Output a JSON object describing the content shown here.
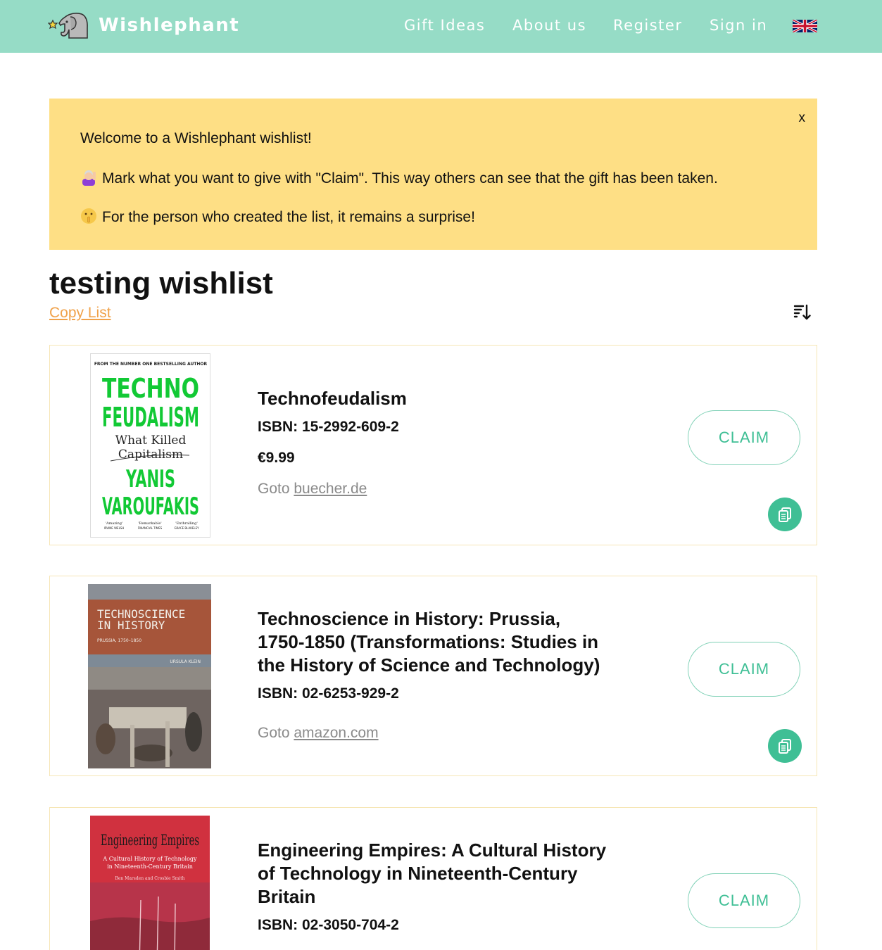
{
  "header": {
    "brand": "Wishlephant",
    "nav": [
      "Gift Ideas",
      "About us",
      "Register",
      "Sign in"
    ],
    "language_icon": "uk-flag-icon",
    "bg_color": "#96dcc6"
  },
  "notice": {
    "close": "x",
    "line1": "Welcome to a Wishlephant wishlist!",
    "line2": "Mark what you want to give with \"Claim\". This way others can see that the gift has been taken.",
    "line3": "For the person who created the list, it remains a surprise!",
    "line2_icon": "woman-raising-hand-icon",
    "line3_icon": "shushing-face-icon",
    "bg_color": "#fedf85"
  },
  "list": {
    "title": "testing wishlist",
    "copy_label": "Copy List",
    "sort_icon": "sort-descending-icon"
  },
  "items": [
    {
      "title": "Technofeudalism",
      "isbn": "ISBN: 15-2992-609-2",
      "price": "€9.99",
      "goto_prefix": "Goto",
      "goto_link": "buecher.de",
      "claim": "CLAIM",
      "cover": {
        "top": "FROM THE NUMBER ONE BESTSELLING AUTHOR",
        "title1": "TECHNO",
        "title2": "FEUDALISM",
        "sub1": "What Killed",
        "sub2": "Capitalism",
        "author1": "YANIS",
        "author2": "VAROUFAKIS",
        "q1": "'Amazing'",
        "q1s": "IRVINE WELSH",
        "q2": "'Remarkable'",
        "q2s": "FINANCIAL TIMES",
        "q3": "'Enthralling'",
        "q3s": "GRACE BLAKELEY"
      }
    },
    {
      "title": "Technoscience in History: Prussia, 1750-1850 (Transformations: Studies in the History of Science and Technology)",
      "isbn": "ISBN: 02-6253-929-2",
      "goto_prefix": "Goto",
      "goto_link": "amazon.com",
      "claim": "CLAIM",
      "cover": {
        "title1": "TECHNOSCIENCE",
        "title2": "IN HISTORY",
        "sub": "PRUSSIA, 1750–1850",
        "author": "URSULA KLEIN"
      }
    },
    {
      "title": "Engineering Empires: A Cultural History of Technology in Nineteenth-Century Britain",
      "isbn": "ISBN: 02-3050-704-2",
      "claim": "CLAIM",
      "cover": {
        "title": "Engineering Empires",
        "sub1": "A Cultural History of Technology",
        "sub2": "in Nineteenth-Century Britain",
        "authors": "Ben Marsden and Crosbie Smith"
      }
    }
  ]
}
